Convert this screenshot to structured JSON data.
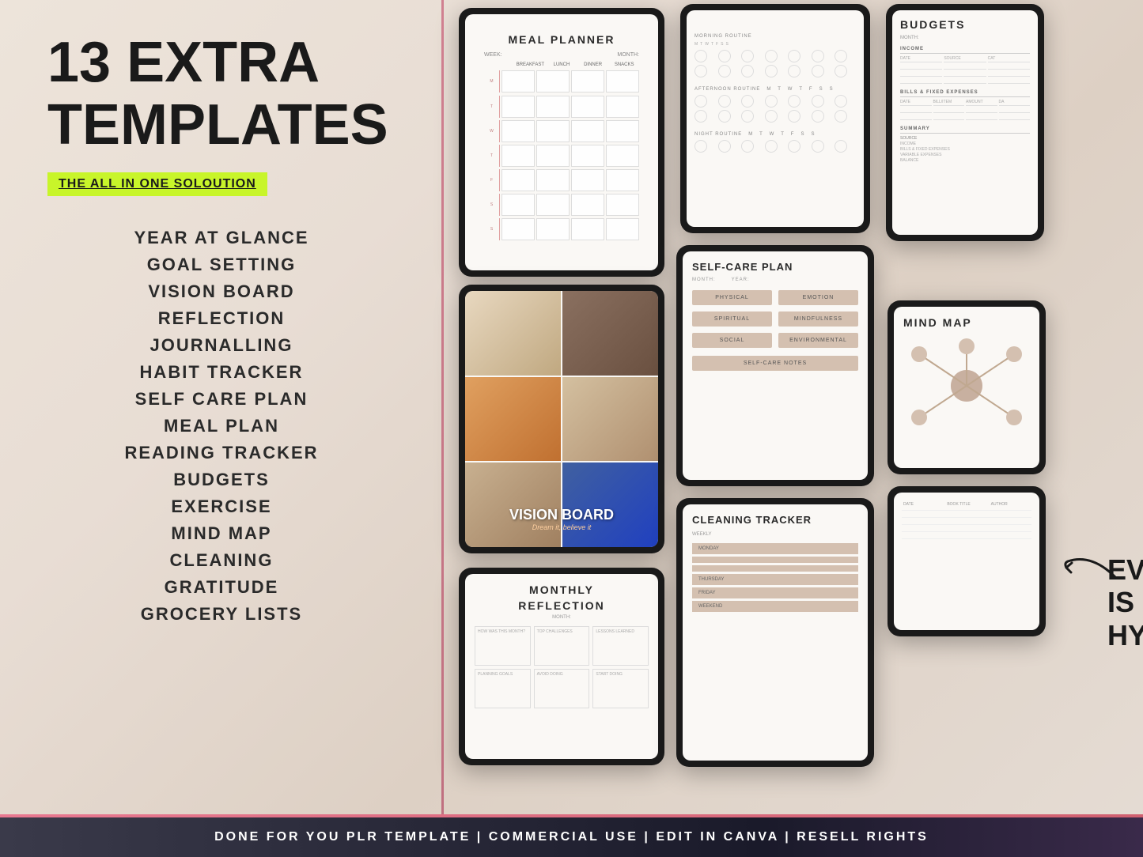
{
  "header": {
    "main_title_line1": "13 EXTRA",
    "main_title_line2": "TEMPLATES",
    "subtitle": "THE ALL IN ONE SOLOUTION"
  },
  "templates": {
    "items": [
      "YEAR AT GLANCE",
      "GOAL SETTING",
      "VISION BOARD",
      "REFLECTION",
      "JOURNALLING",
      "HABIT TRACKER",
      "SELF CARE PLAN",
      "MEAL PLAN",
      "READING TRACKER",
      "BUDGETS",
      "EXERCISE",
      "MIND MAP",
      "CLEANING",
      "GRATITUDE",
      "GROCERY LISTS"
    ]
  },
  "tablets": {
    "meal_planner": {
      "title": "MEAL PLANNER",
      "week_label": "WEEK:",
      "month_label": "MONTH:",
      "days": [
        "BREAKFAST",
        "LUNCH",
        "DINNER",
        "SNACKS"
      ]
    },
    "self_care": {
      "title": "SELF-CARE PLAN",
      "month_label": "MONTH:",
      "year_label": "YEAR:",
      "categories": [
        "PHYSICAL",
        "EMOTION",
        "SPIRITUAL",
        "MINDFULNESS",
        "SOCIAL",
        "ENVIRONMENTAL"
      ],
      "notes_label": "SELF-CARE NOTES"
    },
    "budgets": {
      "title": "BUDGETS",
      "month_label": "MONTH:",
      "income_title": "INCOME",
      "bills_title": "BILLS & FIXED EXPENSES",
      "summary_title": "SUMMARY",
      "cols": [
        "DATE",
        "SOURCE",
        "CAT"
      ],
      "bills_cols": [
        "DATE",
        "BILL/ITEM",
        "AMOUNT",
        "DA"
      ],
      "summary_rows": [
        "INCOME",
        "BILLS & FIXED EXPENSES",
        "VARIABLE EXPENSES",
        "BALANCE"
      ]
    },
    "vision_board": {
      "title": "VISION BOARD",
      "subtitle": "Dream it, believe it"
    },
    "mind_map": {
      "title": "MIND MAP"
    },
    "monthly_reflection": {
      "title": "MONTHLY",
      "title2": "REFLECTION",
      "month_label": "MONTH:",
      "cells": [
        "HOW WAS THIS MONTH?",
        "TOP CHALLENGES",
        "LESSONS LEARNED",
        "PLANNING GOALS",
        "AVOID DOING",
        "START DOING"
      ]
    },
    "cleaning": {
      "title": "CLEANING TRACKER",
      "weekly_label": "WEEKLY",
      "days": [
        "MONDAY",
        "THURSDAY",
        "FRIDAY",
        "WEEKEND"
      ]
    },
    "reading": {
      "cols": [
        "DATE",
        "BOOK TITLE",
        "AUTHOR"
      ]
    }
  },
  "callout": {
    "text_line1": "EVERY PAGE IS",
    "text_line2": "HYPERLINKED"
  },
  "banner": {
    "text": "DONE FOR YOU PLR TEMPLATE  |  COMMERCIAL USE  |  EDIT IN CANVA  |  RESELL RIGHTS"
  }
}
